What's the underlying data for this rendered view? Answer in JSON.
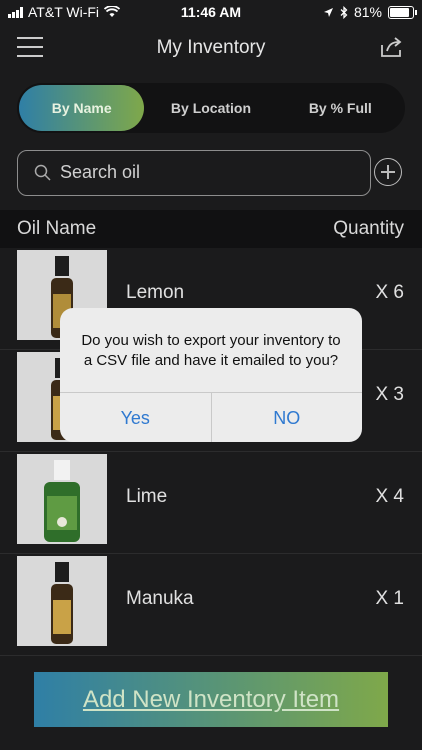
{
  "status": {
    "carrier": "AT&T Wi-Fi",
    "time": "11:46 AM",
    "battery": "81%"
  },
  "nav": {
    "title": "My Inventory"
  },
  "segments": [
    {
      "label": "By Name",
      "active": true
    },
    {
      "label": "By Location",
      "active": false
    },
    {
      "label": "By % Full",
      "active": false
    }
  ],
  "search": {
    "placeholder": "Search oil"
  },
  "columns": {
    "name": "Oil Name",
    "quantity": "Quantity"
  },
  "oils": [
    {
      "name": "Lemon",
      "qty": "X 6"
    },
    {
      "name": "",
      "qty": "X 3"
    },
    {
      "name": "Lime",
      "qty": "X 4"
    },
    {
      "name": "Manuka",
      "qty": "X 1"
    }
  ],
  "add_button": "Add New Inventory Item",
  "dialog": {
    "line1": "Do you wish to export your inventory to",
    "line2": "a CSV file and have it emailed to you?",
    "yes": "Yes",
    "no": "NO"
  },
  "colors": {
    "accent_start": "#2f7fa6",
    "accent_end": "#7fa84a",
    "dialog_button": "#2f79d0"
  }
}
